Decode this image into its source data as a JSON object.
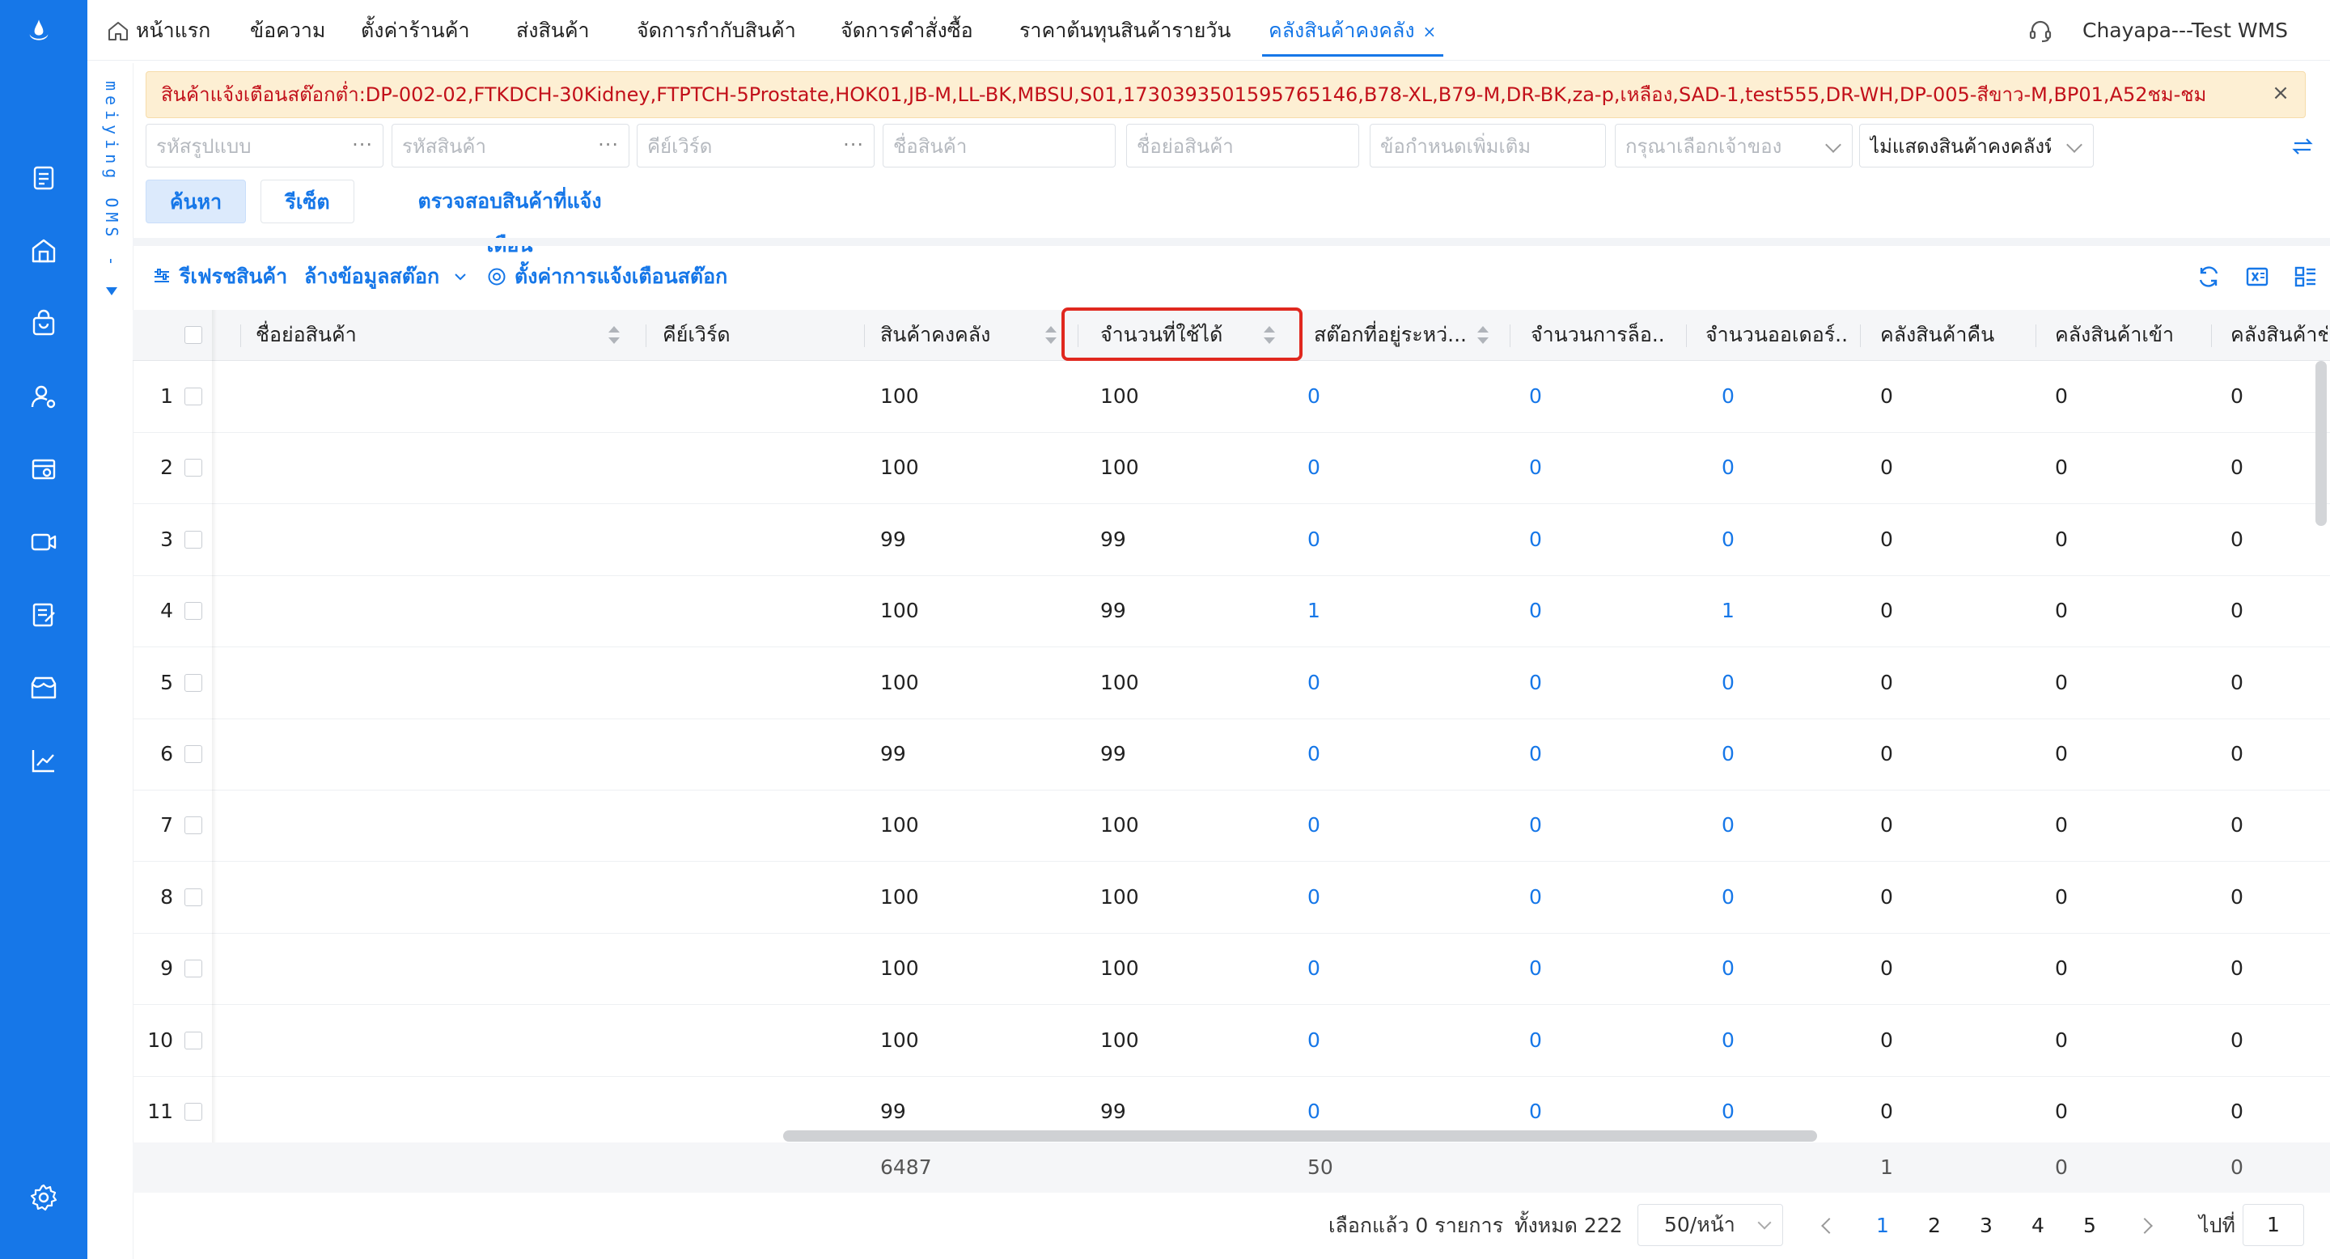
{
  "nav": {
    "tabs": [
      {
        "label": "หน้าแรก"
      },
      {
        "label": "ข้อความ"
      },
      {
        "label": "ตั้งค่าร้านค้า"
      },
      {
        "label": "ส่งสินค้า"
      },
      {
        "label": "จัดการกำกับสินค้า"
      },
      {
        "label": "จัดการคำสั่งซื้อ"
      },
      {
        "label": "ราคาต้นทุนสินค้ารายวัน"
      },
      {
        "label": "คลังสินค้าคงคลัง"
      }
    ],
    "close_glyph": "×",
    "user": "Chayapa---Test WMS"
  },
  "side_strip": "meiying OMS -",
  "alert": {
    "text": "สินค้าแจ้งเตือนสต๊อกต่ำ:DP-002-02,FTKDCH-30Kidney,FTPTCH-5Prostate,HOK01,JB-M,LL-BK,MBSU,S01,1730393501595765146,B78-XL,B79-M,DR-BK,za-p,เหลือง,SAD-1,test555,DR-WH,DP-005-สีขาว-M,BP01,A52ชม-ชม",
    "close": "×"
  },
  "filters": [
    {
      "placeholder": "รหัสรูปแบบ",
      "dots": "···"
    },
    {
      "placeholder": "รหัสสินค้า",
      "dots": "···"
    },
    {
      "placeholder": "คีย์เวิร์ด",
      "dots": "···"
    },
    {
      "placeholder": "ชื่อสินค้า"
    },
    {
      "placeholder": "ชื่อย่อสินค้า"
    },
    {
      "placeholder": "ข้อกำหนดเพิ่มเติม"
    },
    {
      "placeholder": "กรุณาเลือกเจ้าของ"
    },
    {
      "value": "ไม่แสดงสินค้าคงคลังที่"
    }
  ],
  "buttons": {
    "search": "ค้นหา",
    "reset": "รีเซ็ต",
    "check": "ตรวจสอบสินค้าที่แจ้งเตือน"
  },
  "toolbar": {
    "refresh": "รีเฟรชสินค้า",
    "clear": "ล้างข้อมูลสต๊อก",
    "settings": "ตั้งค่าการแจ้งเตือนสต๊อก"
  },
  "columns": [
    "ชื่อย่อสินค้า",
    "คีย์เวิร์ด",
    "สินค้าคงคลัง",
    "จำนวนที่ใช้ได้",
    "สต๊อกที่อยู่ระหว่...",
    "จำนวนการล็อ...",
    "จำนวนออเดอร์...",
    "คลังสินค้าคืน",
    "คลังสินค้าเข้า",
    "คลังสินค้าชำ"
  ],
  "rows": [
    {
      "n": "1",
      "stock": "100",
      "avail": "100",
      "transit": "0",
      "lock": "0",
      "orders": "0",
      "ret": "0",
      "in": "0",
      "dmg": "0"
    },
    {
      "n": "2",
      "stock": "100",
      "avail": "100",
      "transit": "0",
      "lock": "0",
      "orders": "0",
      "ret": "0",
      "in": "0",
      "dmg": "0"
    },
    {
      "n": "3",
      "stock": "99",
      "avail": "99",
      "transit": "0",
      "lock": "0",
      "orders": "0",
      "ret": "0",
      "in": "0",
      "dmg": "0"
    },
    {
      "n": "4",
      "stock": "100",
      "avail": "99",
      "transit": "1",
      "lock": "0",
      "orders": "1",
      "ret": "0",
      "in": "0",
      "dmg": "0"
    },
    {
      "n": "5",
      "stock": "100",
      "avail": "100",
      "transit": "0",
      "lock": "0",
      "orders": "0",
      "ret": "0",
      "in": "0",
      "dmg": "0"
    },
    {
      "n": "6",
      "stock": "99",
      "avail": "99",
      "transit": "0",
      "lock": "0",
      "orders": "0",
      "ret": "0",
      "in": "0",
      "dmg": "0"
    },
    {
      "n": "7",
      "stock": "100",
      "avail": "100",
      "transit": "0",
      "lock": "0",
      "orders": "0",
      "ret": "0",
      "in": "0",
      "dmg": "0"
    },
    {
      "n": "8",
      "stock": "100",
      "avail": "100",
      "transit": "0",
      "lock": "0",
      "orders": "0",
      "ret": "0",
      "in": "0",
      "dmg": "0"
    },
    {
      "n": "9",
      "stock": "100",
      "avail": "100",
      "transit": "0",
      "lock": "0",
      "orders": "0",
      "ret": "0",
      "in": "0",
      "dmg": "0"
    },
    {
      "n": "10",
      "stock": "100",
      "avail": "100",
      "transit": "0",
      "lock": "0",
      "orders": "0",
      "ret": "0",
      "in": "0",
      "dmg": "0"
    },
    {
      "n": "11",
      "stock": "99",
      "avail": "99",
      "transit": "0",
      "lock": "0",
      "orders": "0",
      "ret": "0",
      "in": "0",
      "dmg": "0"
    }
  ],
  "summary": {
    "stock": "6487",
    "transit": "50",
    "ret": "1",
    "in": "0",
    "dmg": "0"
  },
  "pagination": {
    "selected": "เลือกแล้ว 0 รายการ",
    "total": "ทั้งหมด 222",
    "page_size": "50/หน้า",
    "pages": [
      "1",
      "2",
      "3",
      "4",
      "5"
    ],
    "goto_label": "ไปที่",
    "goto_value": "1"
  },
  "colors": {
    "primary": "#1677e8",
    "alert_bg": "#fdefd3",
    "alert_text": "#c2101a",
    "highlight": "#e0281f"
  }
}
